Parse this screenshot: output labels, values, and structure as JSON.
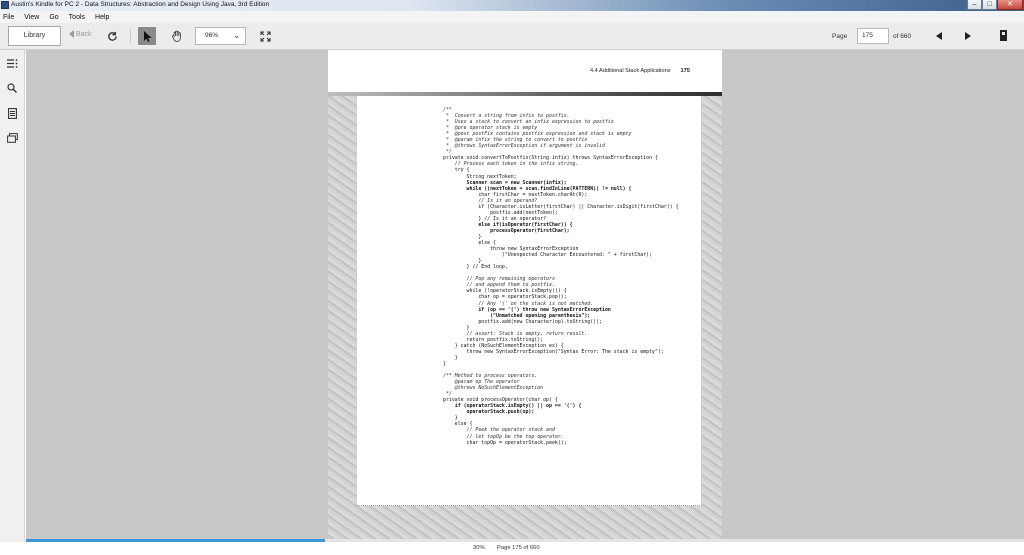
{
  "window": {
    "title": "Austin's Kindle for PC 2 - Data Structures: Abstraction and Design Using Java, 3rd Edition",
    "min_glyph": "–",
    "max_glyph": "□",
    "close_glyph": "✕"
  },
  "menu": [
    "File",
    "View",
    "Go",
    "Tools",
    "Help"
  ],
  "toolbar": {
    "library_label": "Library",
    "back_label": "Back",
    "zoom_value": "96%",
    "page_label": "Page",
    "page_value": "175",
    "page_total": "of 660"
  },
  "icons": {
    "refresh": "refresh-icon",
    "select": "arrow-pointer-icon",
    "hand": "hand-pan-icon",
    "fullscreen": "expand-icon",
    "bookmark": "bookmark-icon",
    "toc": "table-of-contents-icon",
    "search": "search-icon",
    "notes": "notes-icon",
    "flashcards": "flashcards-icon"
  },
  "book": {
    "running_head": "4.4 Additional Stack Applications",
    "page_number": "175",
    "code_lines": [
      {
        "t": "/**",
        "c": true
      },
      {
        "t": " *  Convert a string from infix to postfix.",
        "c": true
      },
      {
        "t": " *  Uses a stack to convert an infix expression to postfix",
        "c": true
      },
      {
        "t": " *  @pre operator stack is empty",
        "c": true
      },
      {
        "t": " *  @post postFix contains postfix expression and stack is empty",
        "c": true
      },
      {
        "t": " *  @param infix the string to convert to postfix",
        "c": true
      },
      {
        "t": " *  @throws SyntaxErrorException if argument is invalid",
        "c": true
      },
      {
        "t": " */",
        "c": true
      },
      {
        "t": "private void convertToPostfix(String infix) throws SyntaxErrorException {"
      },
      {
        "t": "    // Process each token in the infix string.",
        "c": true
      },
      {
        "t": "    try {"
      },
      {
        "t": "        String nextToken;"
      },
      {
        "t": "        Scanner scan = new Scanner(infix);",
        "b": true
      },
      {
        "t": "        while ((nextToken = scan.findInLine(PATTERN)) != null) {",
        "b": true
      },
      {
        "t": "            char firstChar = nextToken.charAt(0);"
      },
      {
        "t": "            // Is it an operand?",
        "c": true
      },
      {
        "t": "            if (Character.isLetter(firstChar) || Character.isDigit(firstChar)) {"
      },
      {
        "t": "                postfix.add(nextToken);"
      },
      {
        "t": "            } // Is it an operator?"
      },
      {
        "t": "            else if(isOperator(firstChar)) {",
        "b": true
      },
      {
        "t": "                processOperator(firstChar);",
        "b": true
      },
      {
        "t": "            }"
      },
      {
        "t": "            else {"
      },
      {
        "t": "                throw new SyntaxErrorException"
      },
      {
        "t": "                    (\"Unexpected Character Encountered: \" + firstChar);"
      },
      {
        "t": "            }"
      },
      {
        "t": "        } // End loop."
      },
      {
        "t": ""
      },
      {
        "t": "        // Pop any remaining operators",
        "c": true
      },
      {
        "t": "        // and append them to postfix.",
        "c": true
      },
      {
        "t": "        while (!operatorStack.isEmpty()) {"
      },
      {
        "t": "            char op = operatorStack.pop();"
      },
      {
        "t": "            // Any '(' on the stack is not matched.",
        "c": true
      },
      {
        "t": "            if (op == '(') throw new SyntaxErrorException",
        "b": true
      },
      {
        "t": "                (\"Unmatched opening parenthesis\");",
        "b": true
      },
      {
        "t": "            postfix.add(new Character(op).toString());"
      },
      {
        "t": "        }"
      },
      {
        "t": "        // assert: Stack is empty, return result.",
        "c": true
      },
      {
        "t": "        return postfix.toString();"
      },
      {
        "t": "    } catch (NoSuchElementException ex) {"
      },
      {
        "t": "        throw new SyntaxErrorException(\"Syntax Error: The stack is empty\");"
      },
      {
        "t": "    }"
      },
      {
        "t": "}"
      },
      {
        "t": ""
      },
      {
        "t": "/** Method to process operators.",
        "c": true
      },
      {
        "t": "    @param op The operator",
        "c": true
      },
      {
        "t": "    @throws NoSuchElementException",
        "c": true
      },
      {
        "t": " */",
        "c": true
      },
      {
        "t": "private void processOperator(char op) {"
      },
      {
        "t": "    if (operatorStack.isEmpty() || op == '(') {",
        "b": true
      },
      {
        "t": "        operatorStack.push(op);",
        "b": true
      },
      {
        "t": "    }"
      },
      {
        "t": "    else {"
      },
      {
        "t": "        // Peek the operator stack and",
        "c": true
      },
      {
        "t": "        // let topOp be the top operator.",
        "c": true
      },
      {
        "t": "        char topOp = operatorStack.peek();"
      }
    ]
  },
  "status": {
    "percent": "30%",
    "progress_fraction": 0.3,
    "page_info": "Page 175 of 660"
  }
}
